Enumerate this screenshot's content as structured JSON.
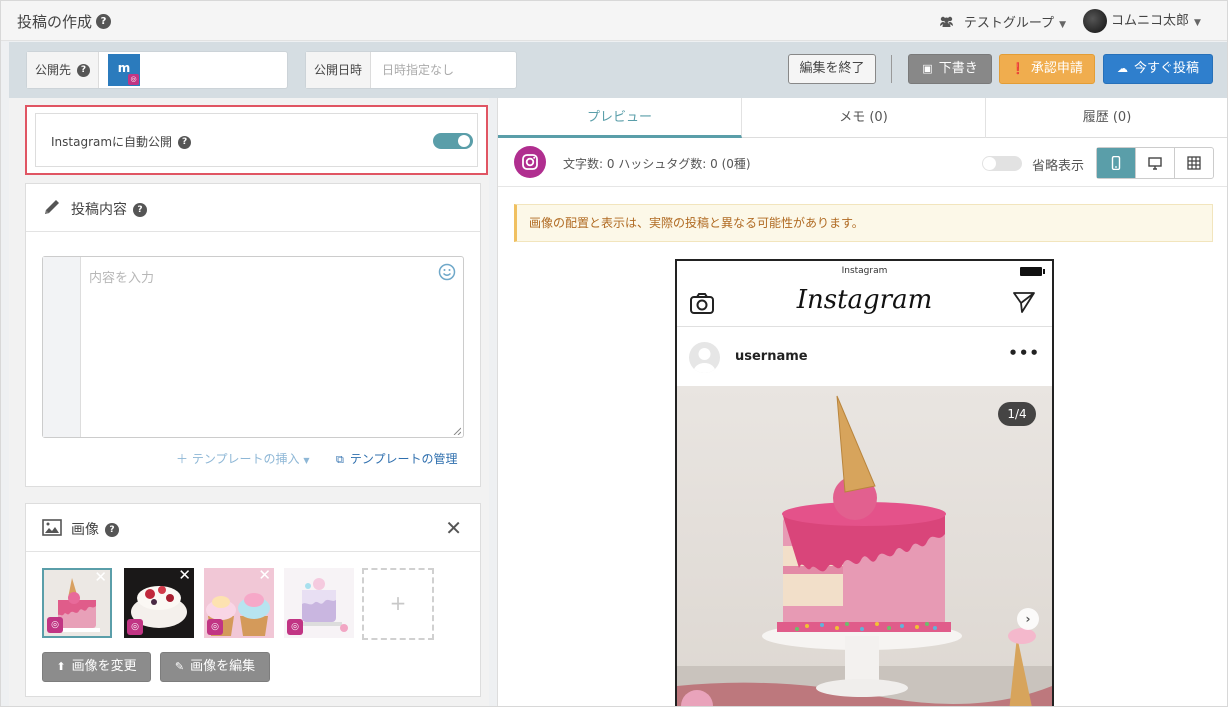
{
  "header": {
    "title": "投稿の作成",
    "help_glyph": "?",
    "group": "テストグループ",
    "user": "コムニコ太郎"
  },
  "toolbar": {
    "destination_label": "公開先",
    "destination_account_initial": "m",
    "publish_date_label": "公開日時",
    "publish_date_placeholder": "日時指定なし",
    "end_edit_label": "編集を終了",
    "draft_label": "下書き",
    "approval_label": "承認申請",
    "post_now_label": "今すぐ投稿"
  },
  "left": {
    "auto_publish": {
      "label": "Instagramに自動公開",
      "enabled": true
    },
    "content": {
      "title": "投稿内容",
      "placeholder": "内容を入力",
      "template_insert": "テンプレートの挿入",
      "template_manage": "テンプレートの管理"
    },
    "images": {
      "title": "画像",
      "thumbnails": [
        {
          "name": "thumb-1",
          "selected": true
        },
        {
          "name": "thumb-2",
          "selected": false
        },
        {
          "name": "thumb-3",
          "selected": false
        },
        {
          "name": "thumb-4",
          "selected": false
        }
      ],
      "add_glyph": "+",
      "change_label": "画像を変更",
      "edit_label": "画像を編集"
    }
  },
  "right": {
    "tabs": [
      {
        "label": "プレビュー",
        "active": true
      },
      {
        "label": "メモ (0)",
        "active": false
      },
      {
        "label": "履歴 (0)",
        "active": false
      }
    ],
    "stats": "文字数: 0 ハッシュタグ数: 0 (0種)",
    "omit_label": "省略表示",
    "omit_enabled": false,
    "notice": "画像の配置と表示は、実際の投稿と異なる可能性があります。",
    "preview": {
      "status_title": "Instagram",
      "logo": "Instagram",
      "username": "username",
      "more": "•••",
      "counter": "1/4",
      "next": "›"
    }
  },
  "colors": {
    "accent": "#5a9ea9",
    "highlight": "#e05563",
    "instagram": "#c13584",
    "approve": "#f0ad4e",
    "post": "#2f7fcd"
  }
}
